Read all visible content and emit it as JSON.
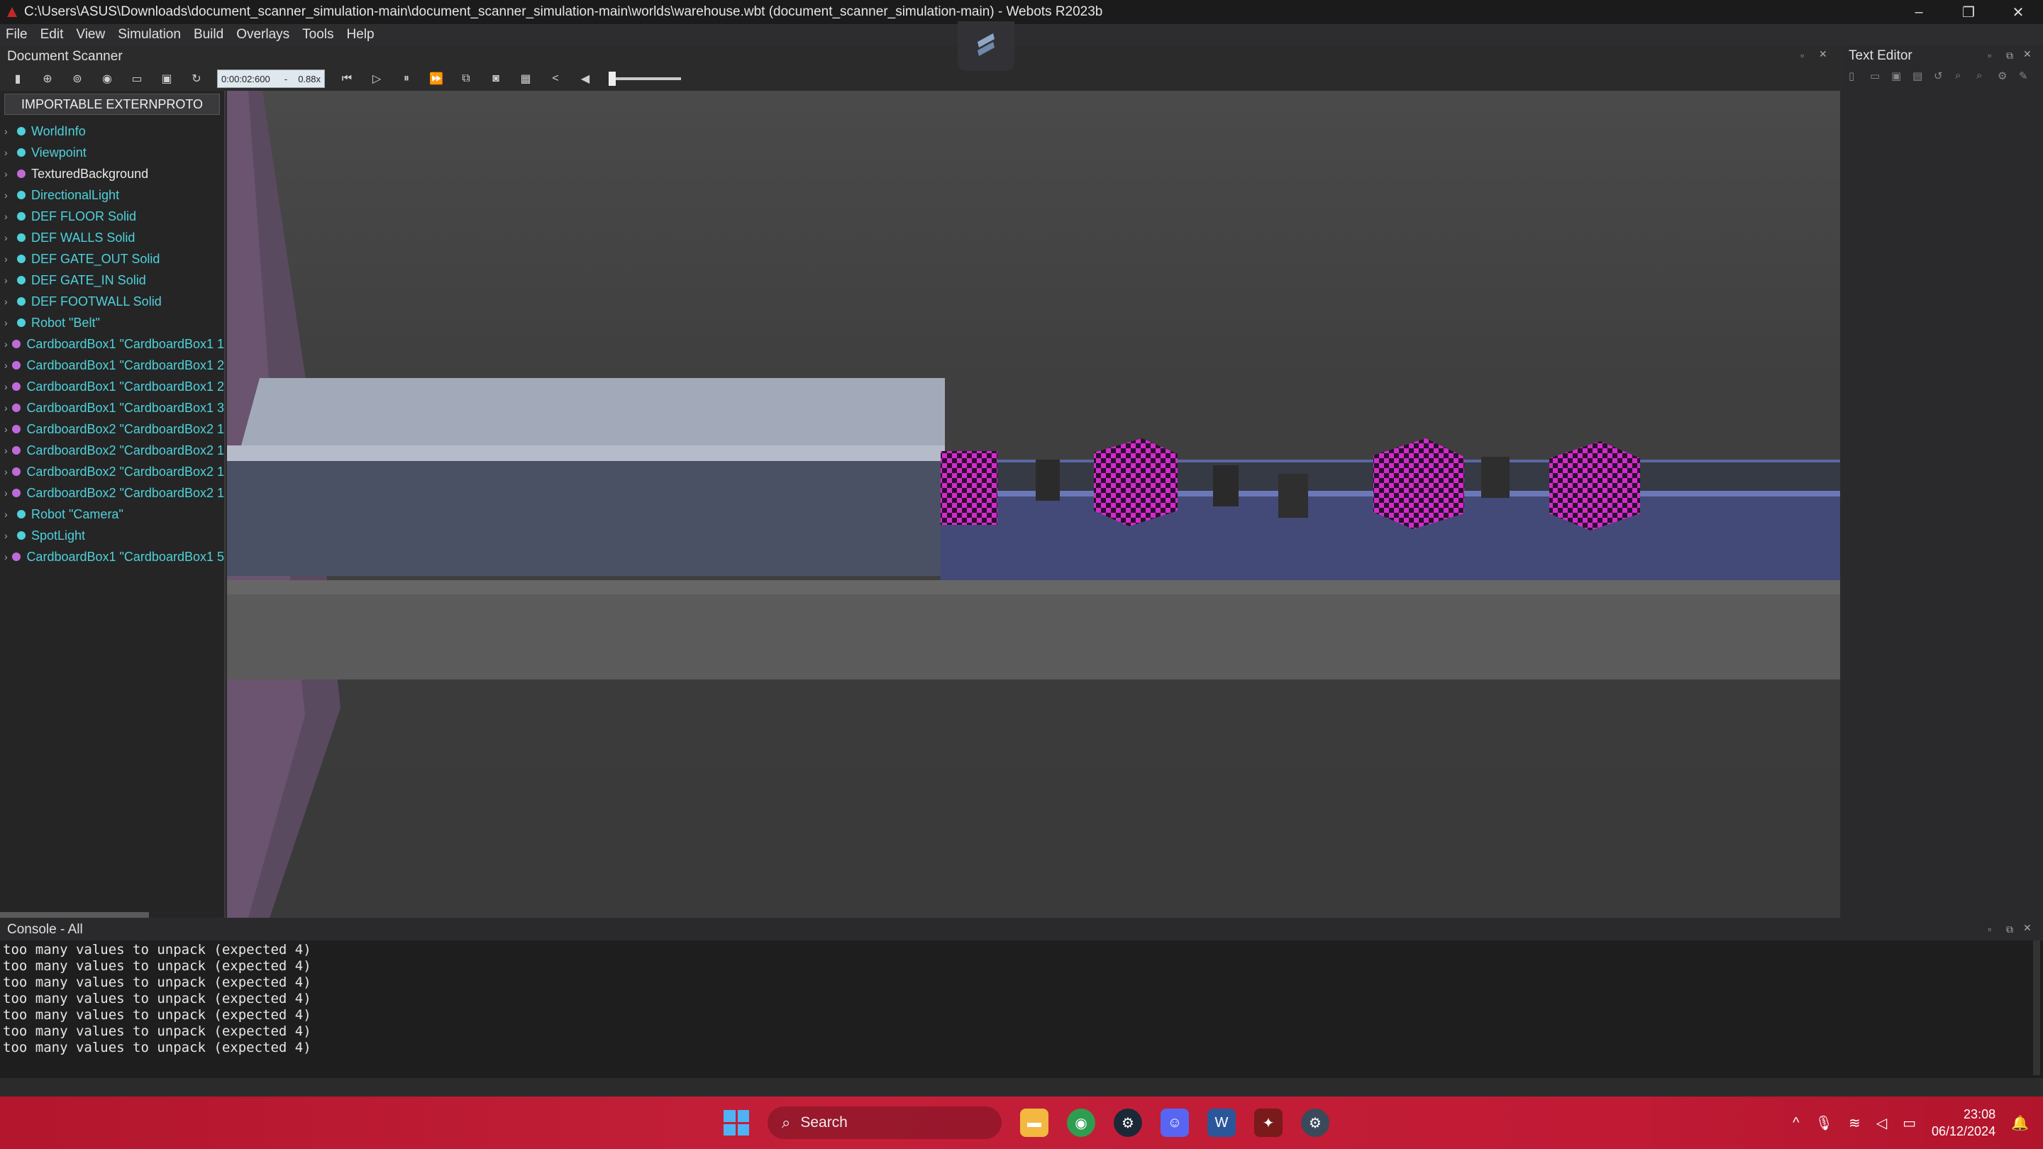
{
  "window": {
    "title": "C:\\Users\\ASUS\\Downloads\\document_scanner_simulation-main\\document_scanner_simulation-main\\worlds\\warehouse.wbt (document_scanner_simulation-main) - Webots R2023b",
    "controls": {
      "minimize": "–",
      "restore": "❐",
      "close": "✕"
    }
  },
  "menu": [
    "File",
    "Edit",
    "View",
    "Simulation",
    "Build",
    "Overlays",
    "Tools",
    "Help"
  ],
  "scene_panel": {
    "title": "Document Scanner",
    "proto_button": "IMPORTABLE EXTERNPROTO",
    "nodes": [
      {
        "label": "WorldInfo",
        "color": "#4fd1d9"
      },
      {
        "label": "Viewpoint",
        "color": "#4fd1d9"
      },
      {
        "label": "TexturedBackground",
        "color": "#c06ad8"
      },
      {
        "label": "DirectionalLight",
        "color": "#4fd1d9"
      },
      {
        "label": "DEF FLOOR Solid",
        "color": "#4fd1d9"
      },
      {
        "label": "DEF WALLS Solid",
        "color": "#4fd1d9"
      },
      {
        "label": "DEF GATE_OUT Solid",
        "color": "#4fd1d9"
      },
      {
        "label": "DEF GATE_IN Solid",
        "color": "#4fd1d9"
      },
      {
        "label": "DEF FOOTWALL Solid",
        "color": "#4fd1d9"
      },
      {
        "label": "Robot \"Belt\"",
        "color": "#4fd1d9"
      },
      {
        "label": "CardboardBox1 \"CardboardBox1 1",
        "color": "#c06ad8"
      },
      {
        "label": "CardboardBox1 \"CardboardBox1 2",
        "color": "#c06ad8"
      },
      {
        "label": "CardboardBox1 \"CardboardBox1 2",
        "color": "#c06ad8"
      },
      {
        "label": "CardboardBox1 \"CardboardBox1 3",
        "color": "#c06ad8"
      },
      {
        "label": "CardboardBox2 \"CardboardBox2 1",
        "color": "#c06ad8"
      },
      {
        "label": "CardboardBox2 \"CardboardBox2 1",
        "color": "#c06ad8"
      },
      {
        "label": "CardboardBox2 \"CardboardBox2 1",
        "color": "#c06ad8"
      },
      {
        "label": "CardboardBox2 \"CardboardBox2 1",
        "color": "#c06ad8"
      },
      {
        "label": "Robot \"Camera\"",
        "color": "#4fd1d9"
      },
      {
        "label": "SpotLight",
        "color": "#4fd1d9"
      },
      {
        "label": "CardboardBox1 \"CardboardBox1 5",
        "color": "#c06ad8"
      }
    ]
  },
  "toolbar": {
    "time": "0:00:02:600",
    "separator": "-",
    "speed": "0.88x"
  },
  "text_editor": {
    "title": "Text Editor"
  },
  "console": {
    "title": "Console - All",
    "lines": [
      "too many values to unpack (expected 4)",
      "too many values to unpack (expected 4)",
      "too many values to unpack (expected 4)",
      "too many values to unpack (expected 4)",
      "too many values to unpack (expected 4)",
      "too many values to unpack (expected 4)",
      "too many values to unpack (expected 4)"
    ]
  },
  "taskbar": {
    "search_placeholder": "Search",
    "time": "23:08",
    "date": "06/12/2024",
    "accent": "#c41f39"
  }
}
